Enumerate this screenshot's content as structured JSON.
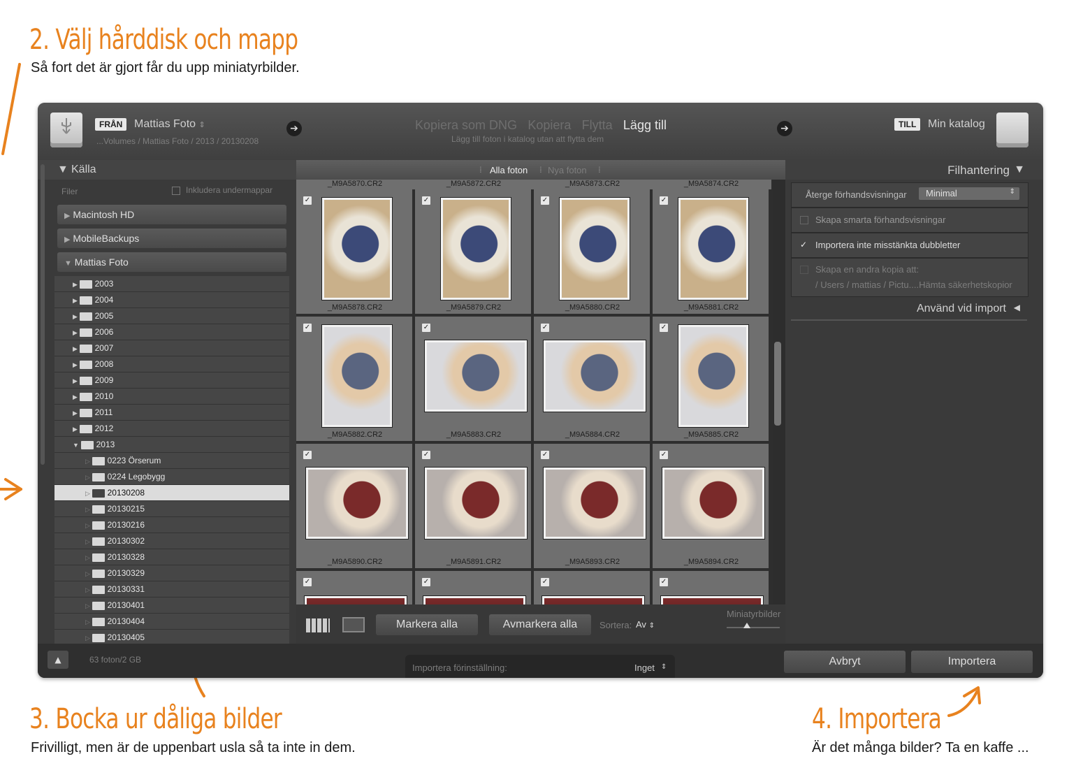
{
  "annotations": [
    {
      "title": "2. Välj hårddisk och mapp",
      "subtitle": "Så fort det är gjort får du upp miniatyrbilder."
    },
    {
      "title": "3. Bocka ur dåliga bilder",
      "subtitle": "Frivilligt, men är de uppenbart usla så ta inte in dem."
    },
    {
      "title": "4. Importera",
      "subtitle": "Är det många bilder? Ta en kaffe ..."
    }
  ],
  "header": {
    "from_badge": "FRÅN",
    "source_name": "Mattias Foto",
    "source_path": "...Volumes / Mattias Foto / 2013 / 20130208",
    "modes": [
      "Kopiera som DNG",
      "Kopiera",
      "Flytta",
      "Lägg till"
    ],
    "active_mode": "Lägg till",
    "mode_desc": "Lägg till foton i katalog utan att flytta dem",
    "to_badge": "TILL",
    "dest_name": "Min katalog"
  },
  "source_panel": {
    "title": "Källa",
    "files_label": "Filer",
    "include_subfolders": "Inkludera undermappar",
    "volumes": [
      "Macintosh HD",
      "MobileBackups",
      "Mattias Foto"
    ],
    "years": [
      "2003",
      "2004",
      "2005",
      "2006",
      "2007",
      "2008",
      "2009",
      "2010",
      "2011",
      "2012",
      "2013"
    ],
    "subfolders": [
      "0223 Örserum",
      "0224 Legobygg",
      "20130208",
      "20130215",
      "20130216",
      "20130302",
      "20130328",
      "20130329",
      "20130331",
      "20130401",
      "20130404",
      "20130405"
    ],
    "selected_folder": "20130208"
  },
  "grid": {
    "tabs": [
      "Alla foton",
      "Nya foton"
    ],
    "active_tab": "Alla foton",
    "top_names": [
      "_M9A5870.CR2",
      "_M9A5872.CR2",
      "_M9A5873.CR2",
      "_M9A5874.CR2"
    ],
    "rows": [
      [
        "_M9A5878.CR2",
        "_M9A5879.CR2",
        "_M9A5880.CR2",
        "_M9A5881.CR2"
      ],
      [
        "_M9A5882.CR2",
        "_M9A5883.CR2",
        "_M9A5884.CR2",
        "_M9A5885.CR2"
      ],
      [
        "_M9A5890.CR2",
        "_M9A5891.CR2",
        "_M9A5893.CR2",
        "_M9A5894.CR2"
      ]
    ],
    "check_mark": "✓"
  },
  "grid_toolbar": {
    "select_all": "Markera alla",
    "deselect_all": "Avmarkera alla",
    "sort_label": "Sortera:",
    "sort_value": "Av",
    "thumb_label": "Miniatyrbilder"
  },
  "right_panel": {
    "title": "Filhantering",
    "previews_label": "Återge förhandsvisningar",
    "previews_value": "Minimal",
    "smart_previews": "Skapa smarta förhandsvisningar",
    "no_duplicates": "Importera inte misstänkta dubbletter",
    "second_copy": "Skapa en andra kopia att:",
    "second_copy_path": "/ Users / mattias / Pictu....Hämta säkerhetskopior",
    "apply_on_import": "Använd vid import"
  },
  "bottom": {
    "count": "63 foton/2 GB",
    "preset_label": "Importera förinställning:",
    "preset_value": "Inget",
    "cancel": "Avbryt",
    "import": "Importera"
  },
  "colors": {
    "accent": "#e8821e",
    "window": "#3b3b3b",
    "grid_cell": "#6f6f6f"
  }
}
